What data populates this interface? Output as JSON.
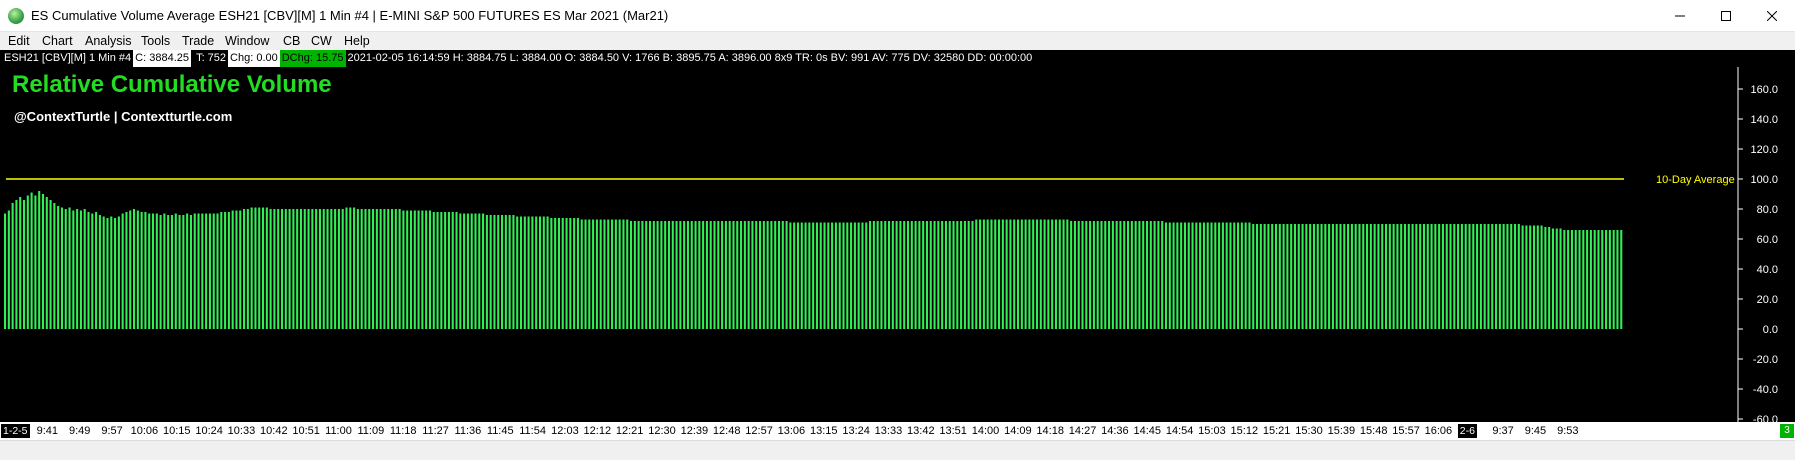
{
  "window": {
    "title": "ES Cumulative Volume Average ESH21 [CBV][M]  1 Min   #4 | E-MINI S&P 500 FUTURES ES Mar 2021 (Mar21)",
    "minimize_icon": "minimize-icon",
    "maximize_icon": "maximize-icon",
    "close_icon": "close-icon"
  },
  "menu": {
    "items": [
      "Edit",
      "Chart",
      "Analysis",
      "Tools",
      "Trade",
      "Window",
      "CB",
      "CW",
      "Help"
    ]
  },
  "infobar": {
    "symbol": "ESH21 [CBV][M]  1 Min   #4",
    "close": "C: 3884.25",
    "ticks": "T: 752",
    "change": "Chg: 0.00",
    "daily_change": "DChg: 15.75",
    "rest": "2021-02-05 16:14:59 H: 3884.75 L: 3884.00 O: 3884.50 V: 1766 B: 3895.75 A: 3896.00 8x9 TR: 0s BV: 991 AV: 775 DV: 32580 DD: 00:00:00"
  },
  "chart": {
    "title": "Relative Cumulative Volume",
    "subtitle": "@ContextTurtle | Contextturtle.com",
    "reference_label": "10-Day Average",
    "bar_color": "#33ee55",
    "reference_color": "#ffff00"
  },
  "chart_data": {
    "type": "bar",
    "ylim": [
      -60,
      170
    ],
    "yticks": [
      160.0,
      140.0,
      120.0,
      100.0,
      80.0,
      60.0,
      40.0,
      20.0,
      0.0,
      -20.0,
      -40.0,
      -60.0
    ],
    "ytick_labels": [
      "160.0",
      "140.0",
      "120.0",
      "100.0",
      "80.0",
      "60.0",
      "40.0",
      "20.0",
      "0.0",
      "-20.0",
      "-40.0",
      "-60.0"
    ],
    "reference_line": 100,
    "bar_count": 417,
    "values": [
      77,
      79,
      84,
      86,
      88,
      86,
      89,
      91,
      89,
      92,
      90,
      88,
      86,
      84,
      82,
      81,
      80,
      81,
      79,
      80,
      79,
      80,
      78,
      77,
      78,
      76,
      75,
      74,
      75,
      74,
      75,
      77,
      78,
      79,
      80,
      79,
      78,
      78,
      77,
      77,
      77,
      76,
      77,
      76,
      76,
      77,
      76,
      76,
      77,
      76,
      77,
      77,
      77,
      77,
      77,
      77,
      77,
      78,
      78,
      78,
      79,
      79,
      79,
      80,
      80,
      81,
      81,
      81,
      81,
      81,
      80,
      80,
      80,
      80,
      80,
      80,
      80,
      80,
      80,
      80,
      80,
      80,
      80,
      80,
      80,
      80,
      80,
      80,
      80,
      80,
      81,
      81,
      81,
      80,
      80,
      80,
      80,
      80,
      80,
      80,
      80,
      80,
      80,
      80,
      80,
      79,
      79,
      79,
      79,
      79,
      79,
      79,
      79,
      78,
      78,
      78,
      78,
      78,
      78,
      78,
      77,
      77,
      77,
      77,
      77,
      77,
      77,
      76,
      76,
      76,
      76,
      76,
      76,
      76,
      76,
      75,
      75,
      75,
      75,
      75,
      75,
      75,
      75,
      75,
      74,
      74,
      74,
      74,
      74,
      74,
      74,
      74,
      73,
      73,
      73,
      73,
      73,
      73,
      73,
      73,
      73,
      73,
      73,
      73,
      73,
      72,
      72,
      72,
      72,
      72,
      72,
      72,
      72,
      72,
      72,
      72,
      72,
      72,
      72,
      72,
      72,
      72,
      72,
      72,
      72,
      72,
      72,
      72,
      72,
      72,
      72,
      72,
      72,
      72,
      72,
      72,
      72,
      72,
      72,
      72,
      72,
      72,
      72,
      72,
      72,
      72,
      72,
      71,
      71,
      71,
      71,
      71,
      71,
      71,
      71,
      71,
      71,
      71,
      71,
      71,
      71,
      71,
      71,
      71,
      71,
      71,
      71,
      71,
      72,
      72,
      72,
      72,
      72,
      72,
      72,
      72,
      72,
      72,
      72,
      72,
      72,
      72,
      72,
      72,
      72,
      72,
      72,
      72,
      72,
      72,
      72,
      72,
      72,
      72,
      72,
      72,
      73,
      73,
      73,
      73,
      73,
      73,
      73,
      73,
      73,
      73,
      73,
      73,
      73,
      73,
      73,
      73,
      73,
      73,
      73,
      73,
      73,
      73,
      73,
      73,
      73,
      72,
      72,
      72,
      72,
      72,
      72,
      72,
      72,
      72,
      72,
      72,
      72,
      72,
      72,
      72,
      72,
      72,
      72,
      72,
      72,
      72,
      72,
      72,
      72,
      72,
      71,
      71,
      71,
      71,
      71,
      71,
      71,
      71,
      71,
      71,
      71,
      71,
      71,
      71,
      71,
      71,
      71,
      71,
      71,
      71,
      71,
      71,
      71,
      70,
      70,
      70,
      70,
      70,
      70,
      70,
      70,
      70,
      70,
      70,
      70,
      70,
      70,
      70,
      70,
      70,
      70,
      70,
      70,
      70,
      70,
      70,
      70,
      70,
      70,
      70,
      70,
      70,
      70,
      70,
      70,
      70,
      70,
      70,
      70,
      70,
      70,
      70,
      70,
      70,
      70,
      70,
      70,
      70,
      70,
      70,
      70,
      70,
      70,
      70,
      70,
      70,
      70,
      70,
      70,
      70,
      70,
      70,
      70,
      70,
      70,
      70,
      70,
      70,
      70,
      70,
      70,
      70,
      70,
      70,
      69,
      69,
      69,
      69,
      69,
      69,
      68,
      68,
      67,
      67,
      67,
      66,
      66,
      66,
      66,
      66,
      66,
      66,
      66,
      66,
      66,
      66,
      66,
      66,
      66,
      66,
      66
    ],
    "x_tick_labels": [
      "1-2-5",
      "9:41",
      "9:49",
      "9:57",
      "10:06",
      "10:15",
      "10:24",
      "10:33",
      "10:42",
      "10:51",
      "11:00",
      "11:09",
      "11:18",
      "11:27",
      "11:36",
      "11:45",
      "11:54",
      "12:03",
      "12:12",
      "12:21",
      "12:30",
      "12:39",
      "12:48",
      "12:57",
      "13:06",
      "13:15",
      "13:24",
      "13:33",
      "13:42",
      "13:51",
      "14:00",
      "14:09",
      "14:18",
      "14:27",
      "14:36",
      "14:45",
      "14:54",
      "15:03",
      "15:12",
      "15:21",
      "15:30",
      "15:39",
      "15:48",
      "15:57",
      "16:06",
      "2-6",
      "9:37",
      "9:45",
      "9:53"
    ],
    "xlabel": "",
    "ylabel": ""
  },
  "statusbar": {
    "corner_badge": "3"
  }
}
